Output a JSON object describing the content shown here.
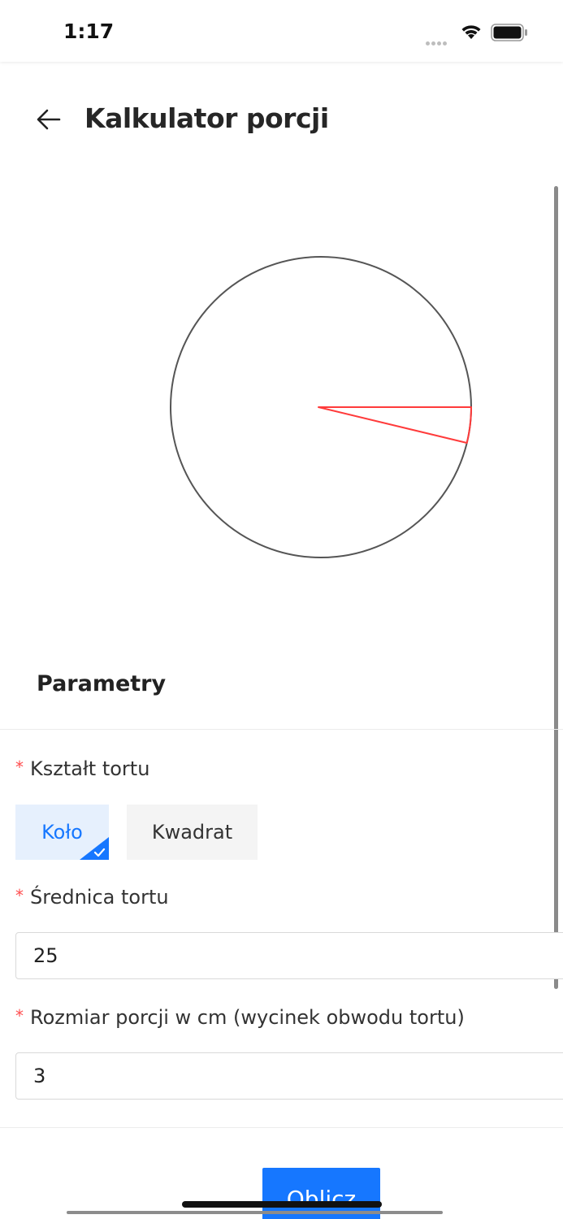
{
  "status_bar": {
    "time": "1:17",
    "icons": [
      "signal-icon",
      "wifi-icon",
      "battery-icon"
    ]
  },
  "header": {
    "title": "Kalkulator porcji",
    "back_icon": "arrow-left-icon"
  },
  "diagram": {
    "shape": "circle",
    "diameter": 25,
    "portion_size_cm": 3,
    "circle_color": "#555555",
    "slice_color": "#ff3b3b"
  },
  "form": {
    "section_title": "Parametry",
    "required_mark": "*",
    "shape": {
      "label": "Kształt tortu",
      "options": [
        "Koło",
        "Kwadrat"
      ],
      "selected": "Koło"
    },
    "diameter": {
      "label": "Średnica tortu",
      "value": "25"
    },
    "portion": {
      "label": "Rozmiar porcji w cm (wycinek obwodu tortu)",
      "value": "3"
    },
    "submit_label": "Oblicz"
  },
  "colors": {
    "accent": "#1677ff",
    "selected_bg": "#e6f0fd",
    "required": "#ff4d4f"
  }
}
